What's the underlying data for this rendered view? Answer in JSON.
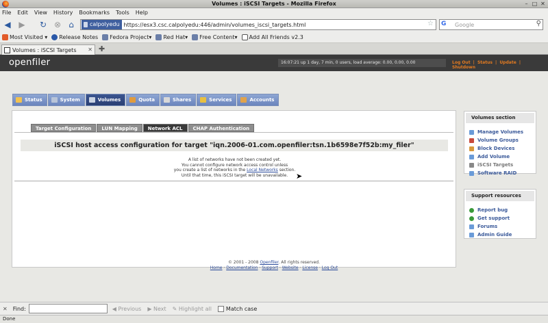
{
  "window": {
    "title": "Volumes : iSCSI Targets - Mozilla Firefox"
  },
  "menubar": [
    "File",
    "Edit",
    "View",
    "History",
    "Bookmarks",
    "Tools",
    "Help"
  ],
  "navbar": {
    "identity": "calpolyedu",
    "url": "https://esx3.csc.calpolyedu:446/admin/volumes_iscsi_targets.html",
    "search_placeholder": "Google"
  },
  "bookmarks": [
    {
      "label": "Most Visited",
      "color": "#e25b2a"
    },
    {
      "label": "Release Notes",
      "color": "#2a58a8"
    },
    {
      "label": "Fedora Project",
      "color": "#6b7fa8"
    },
    {
      "label": "Red Hat",
      "color": "#6b7fa8"
    },
    {
      "label": "Free Content",
      "color": "#6b7fa8"
    },
    {
      "label": "Add All Friends v2.3",
      "color": "#555555"
    }
  ],
  "tab": {
    "label": "Volumes : iSCSI Targets"
  },
  "openfiler": {
    "logo": "openfiler",
    "status": "16:07:21 up 1 day, 7 min, 0 users, load average: 0.00, 0.00, 0.00",
    "toplinks": [
      "Log Out",
      "|",
      "Status",
      "|",
      "Update",
      "|",
      "Shutdown"
    ],
    "navtabs": [
      {
        "label": "Status",
        "color": "#f2c14e"
      },
      {
        "label": "System",
        "color": "#b8c4d8"
      },
      {
        "label": "Volumes",
        "color": "#c9d3e3"
      },
      {
        "label": "Quota",
        "color": "#e09b3d"
      },
      {
        "label": "Shares",
        "color": "#d8d8d8"
      },
      {
        "label": "Services",
        "color": "#e8c040"
      },
      {
        "label": "Accounts",
        "color": "#e0a34c"
      }
    ],
    "subtabs": [
      "Target Configuration",
      "LUN Mapping",
      "Network ACL",
      "CHAP Authentication"
    ],
    "heading": "iSCSI host access configuration for target \"iqn.2006-01.com.openfiler:tsn.1b6598e7f52b:my_filer\"",
    "message": {
      "line1": "A list of networks have not been created yet.",
      "line2": "You cannot configure network access control unless",
      "line3_pre": "you create a list of networks in the ",
      "line3_link": "Local Networks",
      "line3_post": " section.",
      "line4": "Until that time, this iSCSI target will be unavailable."
    },
    "volumes_section": {
      "title": "Volumes section",
      "items": [
        {
          "label": "Manage Volumes",
          "color": "#6a9bd8"
        },
        {
          "label": "Volume Groups",
          "color": "#c84a3c"
        },
        {
          "label": "Block Devices",
          "color": "#d89a3c"
        },
        {
          "label": "Add Volume",
          "color": "#6a9bd8"
        },
        {
          "label": "iSCSI Targets",
          "color": "#888888"
        },
        {
          "label": "Software RAID",
          "color": "#6a9bd8"
        }
      ]
    },
    "support_section": {
      "title": "Support resources",
      "items": [
        {
          "label": "Report bug",
          "color": "#3a9a3a"
        },
        {
          "label": "Get support",
          "color": "#3a9a3a"
        },
        {
          "label": "Forums",
          "color": "#6a9bd8"
        },
        {
          "label": "Admin Guide",
          "color": "#6a9bd8"
        }
      ]
    },
    "footer": {
      "copyright_pre": "© 2001 - 2008 ",
      "copyright_link": "Openfiler",
      "copyright_post": ". All rights reserved.",
      "links": [
        "Home",
        "Documentation",
        "Support",
        "Website",
        "License",
        "Log Out"
      ]
    }
  },
  "findbar": {
    "label": "Find:",
    "previous": "Previous",
    "next": "Next",
    "highlight": "Highlight all",
    "match_case": "Match case"
  },
  "statusbar": {
    "text": "Done"
  }
}
